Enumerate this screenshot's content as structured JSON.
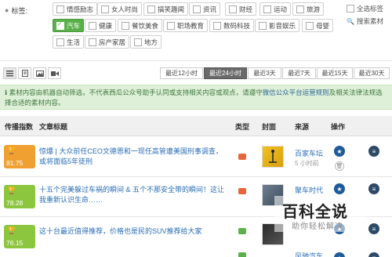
{
  "filter": {
    "label": "标签:",
    "tags": [
      "情感励志",
      "女人时尚",
      "搞笑趣闻",
      "资讯",
      "财经",
      "运动",
      "旅游",
      "汽车",
      "健康",
      "餐饮美食",
      "职场教育",
      "数码科技",
      "影音娱乐",
      "母婴",
      "生活",
      "房产家居",
      "地方"
    ],
    "selected_tag": "汽车",
    "select_all_label": "全选标签",
    "search_label": "搜索素材"
  },
  "toolbar": {
    "type_buttons": [
      "list-icon",
      "article-icon",
      "image-icon",
      "video-icon"
    ],
    "time_buttons": [
      "最近12小时",
      "最近24小时",
      "最近3天",
      "最近7天",
      "最近15天",
      "最近30天"
    ],
    "active_time": "最近24小时"
  },
  "notice": {
    "text_before": "素材内容由机器自动筛选，不代表西瓜公众号助手认同或支持相关内容或观点，请遵守",
    "link_text": "微信公众平台运营规则",
    "text_after": "及相关法律法规选择合适的素材内容。"
  },
  "table": {
    "headers": {
      "score": "传播指数",
      "title": "文章标题",
      "type": "类型",
      "cover": "封面",
      "source": "来源",
      "ops": "操作"
    },
    "rows": [
      {
        "score": "81.75",
        "score_color": "#f0a030",
        "title": "惊爆 | 大众前任CEO文德恩和一现任高管遭美国刑事调查，或将面临5年徒刑",
        "type": "video",
        "source": "百家车坛",
        "time": "5 小时前"
      },
      {
        "score": "78.28",
        "score_color": "#8cc63f",
        "title": "十五个完美躲过车祸的瞬间 & 五个不那安全带的瞬间！这让我重新认识生命……",
        "type": "video",
        "source": "聚车时代",
        "time": ""
      },
      {
        "score": "76.15",
        "score_color": "#8cc63f",
        "title": "这十台最近值得推荐，价格也是民的SUV推荐给大家",
        "type": "image",
        "source": "",
        "time": ""
      },
      {
        "score": "",
        "score_color": "#8cc63f",
        "title": "",
        "type": "image",
        "source": "风驰汽车",
        "time": ""
      }
    ]
  },
  "watermark": {
    "title": "百科全说",
    "subtitle": "助你轻松解决"
  },
  "colors": {
    "accent_blue": "#2a6db5",
    "selected_green": "#5ab04a",
    "notice_bg": "#dff0d8",
    "notice_text": "#3c763d",
    "score_orange": "#f0a030",
    "score_green": "#8cc63f"
  }
}
